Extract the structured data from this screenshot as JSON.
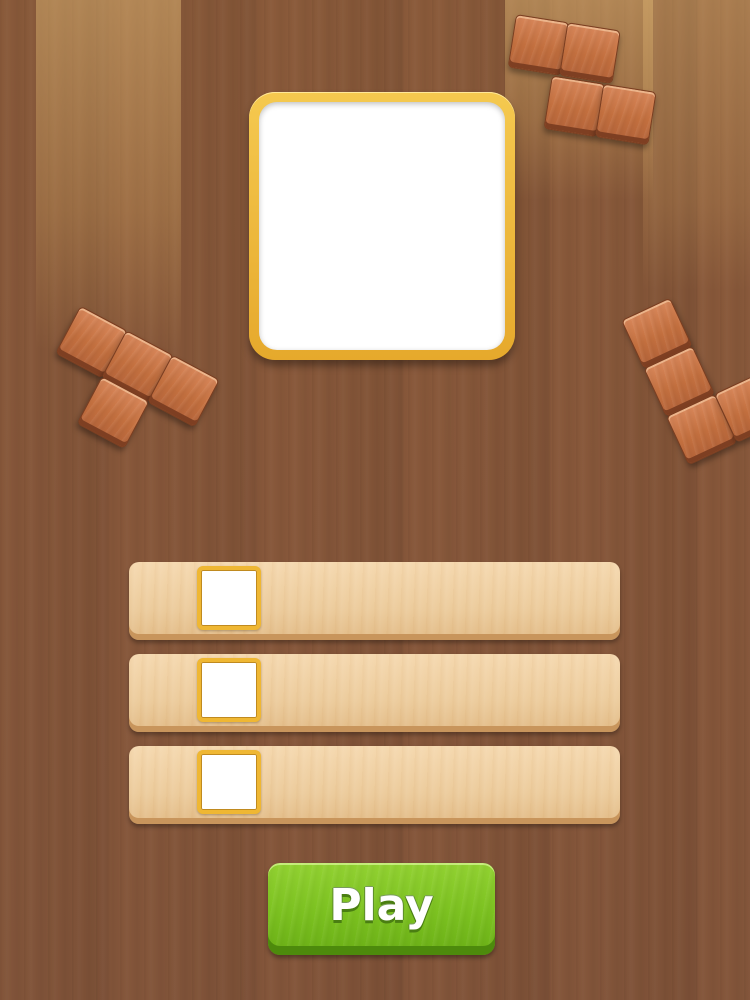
{
  "play_button": {
    "label": "Play"
  },
  "colors": {
    "table_wood": "#87573a",
    "block_wood": "#c4703f",
    "frame_gold": "#efb733",
    "slot_bar_wood": "#eccb9b",
    "play_green": "#7cc220"
  },
  "board_preview": {
    "state": "empty"
  },
  "slots": [
    {
      "state": "empty"
    },
    {
      "state": "empty"
    },
    {
      "state": "empty"
    }
  ],
  "decorative_pieces": [
    {
      "name": "top-right-piece",
      "shape": "S",
      "blocks": 4
    },
    {
      "name": "left-piece",
      "shape": "T",
      "blocks": 4
    },
    {
      "name": "right-piece",
      "shape": "L",
      "blocks": 4
    }
  ]
}
